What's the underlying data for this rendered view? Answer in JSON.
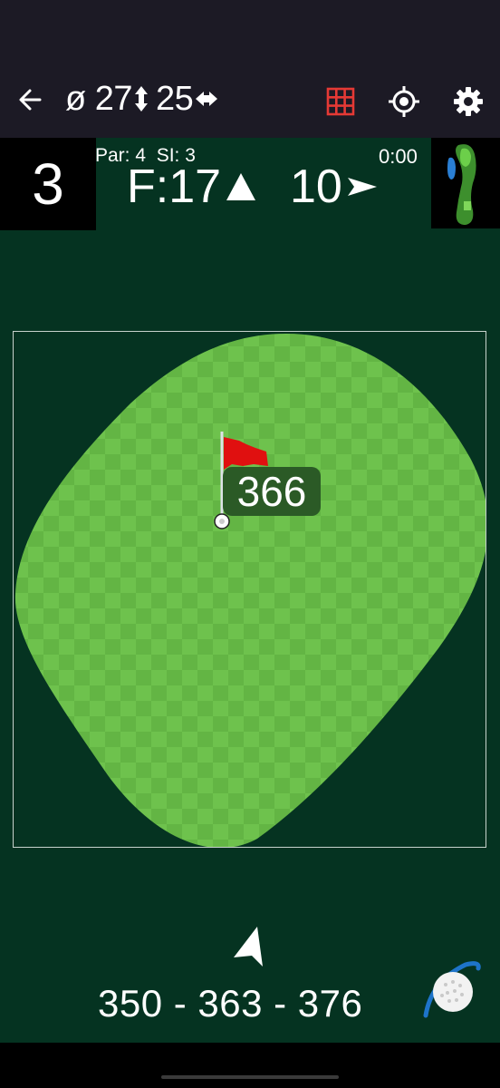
{
  "topbar": {
    "diameter_symbol": "ø",
    "green_depth": "27",
    "green_width": "25"
  },
  "hole": {
    "number": "3",
    "par_si": "Par: 4  SI: 3",
    "timer": "0:00",
    "front": "F:17",
    "layup": "10"
  },
  "green": {
    "pin_distance": "366"
  },
  "bottom": {
    "range": "350 - 363 - 376"
  },
  "colors": {
    "background": "#053321",
    "topbar": "#1c1a25",
    "green_light": "#6fc04c",
    "green_dark": "#63b544",
    "grid_icon": "#e53935",
    "flag": "#e01010"
  },
  "icons": [
    "back-arrow-icon",
    "up-down-arrow-icon",
    "left-right-arrow-icon",
    "grid-icon",
    "target-icon",
    "gear-icon",
    "triangle-up-icon",
    "triangle-right-icon",
    "flag-icon",
    "navigation-arrow-icon",
    "golf-ball-icon",
    "hole-thumbnail"
  ]
}
